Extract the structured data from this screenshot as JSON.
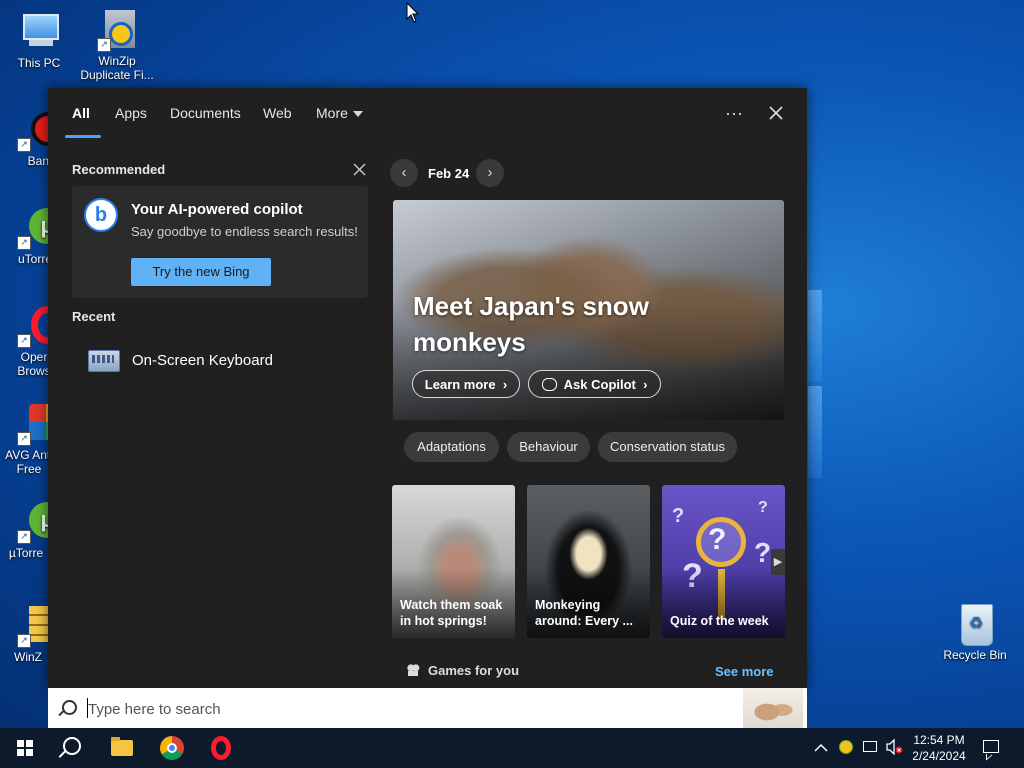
{
  "desktop": {
    "icons": [
      {
        "label": "This PC"
      },
      {
        "label": "WinZip Duplicate Fi..."
      },
      {
        "label": "Bandic"
      },
      {
        "label": "uTorrent"
      },
      {
        "label": "Oper Brows"
      },
      {
        "label": "AVG Anti Free"
      },
      {
        "label": "µTorre"
      },
      {
        "label": "WinZ"
      },
      {
        "label": "Recycle Bin"
      }
    ]
  },
  "search_panel": {
    "tabs": [
      {
        "label": "All",
        "active": true
      },
      {
        "label": "Apps"
      },
      {
        "label": "Documents"
      },
      {
        "label": "Web"
      },
      {
        "label": "More"
      }
    ],
    "more_options_icon": "ellipsis-icon",
    "close_icon": "close-icon",
    "recommended": {
      "title": "Recommended",
      "card": {
        "title": "Your AI-powered copilot",
        "subtitle": "Say goodbye to endless search results!",
        "button": "Try the new Bing"
      }
    },
    "recent": {
      "title": "Recent",
      "items": [
        {
          "label": "On-Screen Keyboard",
          "icon": "keyboard-icon"
        }
      ]
    },
    "highlights": {
      "date": "Feb 24",
      "hero": {
        "title": "Meet Japan's snow monkeys",
        "learn_more": "Learn more",
        "ask_copilot": "Ask Copilot"
      },
      "chips": [
        "Adaptations",
        "Behaviour",
        "Conservation status"
      ],
      "tiles": [
        {
          "label": "Watch them soak in hot springs!"
        },
        {
          "label": "Monkeying around: Every ..."
        },
        {
          "label": "Quiz of the week"
        }
      ],
      "games": {
        "label": "Games for you",
        "see_more": "See more"
      }
    }
  },
  "search_bar": {
    "placeholder": "Type here to search"
  },
  "taskbar": {
    "apps": [
      "start-icon",
      "search-icon",
      "file-explorer-icon",
      "chrome-icon",
      "opera-icon"
    ],
    "clock": {
      "time": "12:54 PM",
      "date": "2/24/2024"
    }
  }
}
